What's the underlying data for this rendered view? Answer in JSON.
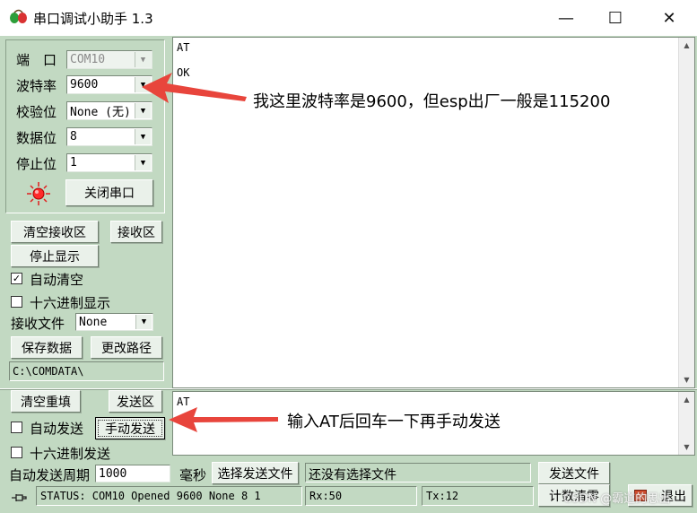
{
  "window": {
    "title": "串口调试小助手 1.3",
    "minimize": "—",
    "maximize": "☐",
    "close": "✕"
  },
  "settings": {
    "port_label": "端　口",
    "port_value": "COM10",
    "baud_label": "波特率",
    "baud_value": "9600",
    "parity_label": "校验位",
    "parity_value": "None (无)",
    "databits_label": "数据位",
    "databits_value": "8",
    "stopbits_label": "停止位",
    "stopbits_value": "1",
    "close_port_button": "关闭串口"
  },
  "receive": {
    "clear_button": "清空接收区",
    "area_button": "接收区",
    "stop_display_button": "停止显示",
    "auto_clear_label": "自动清空",
    "auto_clear_checked": true,
    "hex_display_label": "十六进制显示",
    "hex_display_checked": false,
    "file_label": "接收文件",
    "file_value": "None",
    "save_button": "保存数据",
    "change_path_button": "更改路径",
    "path": "C:\\COMDATA\\",
    "lines": [
      "AT",
      "",
      "OK"
    ]
  },
  "send": {
    "clear_button": "清空重填",
    "area_button": "发送区",
    "auto_send_label": "自动发送",
    "auto_send_checked": false,
    "manual_send_button": "手动发送",
    "hex_send_label": "十六进制发送",
    "hex_send_checked": false,
    "period_label": "自动发送周期",
    "period_value": "1000",
    "ms_label": "毫秒",
    "choose_file_button": "选择发送文件",
    "file_status": "还没有选择文件",
    "send_file_button": "发送文件",
    "text": "AT"
  },
  "status": {
    "text": "STATUS: COM10 Opened 9600 None  8 1",
    "rx": "Rx:50",
    "tx": "Tx:12",
    "reset_count_button": "计数清零",
    "exit_button": "退出",
    "watermark": "CSDN @霸道的思出"
  },
  "annotations": {
    "baud_note": "我这里波特率是9600，但esp出厂一般是115200",
    "send_note": "输入AT后回车一下再手动发送",
    "arrow_color": "#e8453c"
  }
}
